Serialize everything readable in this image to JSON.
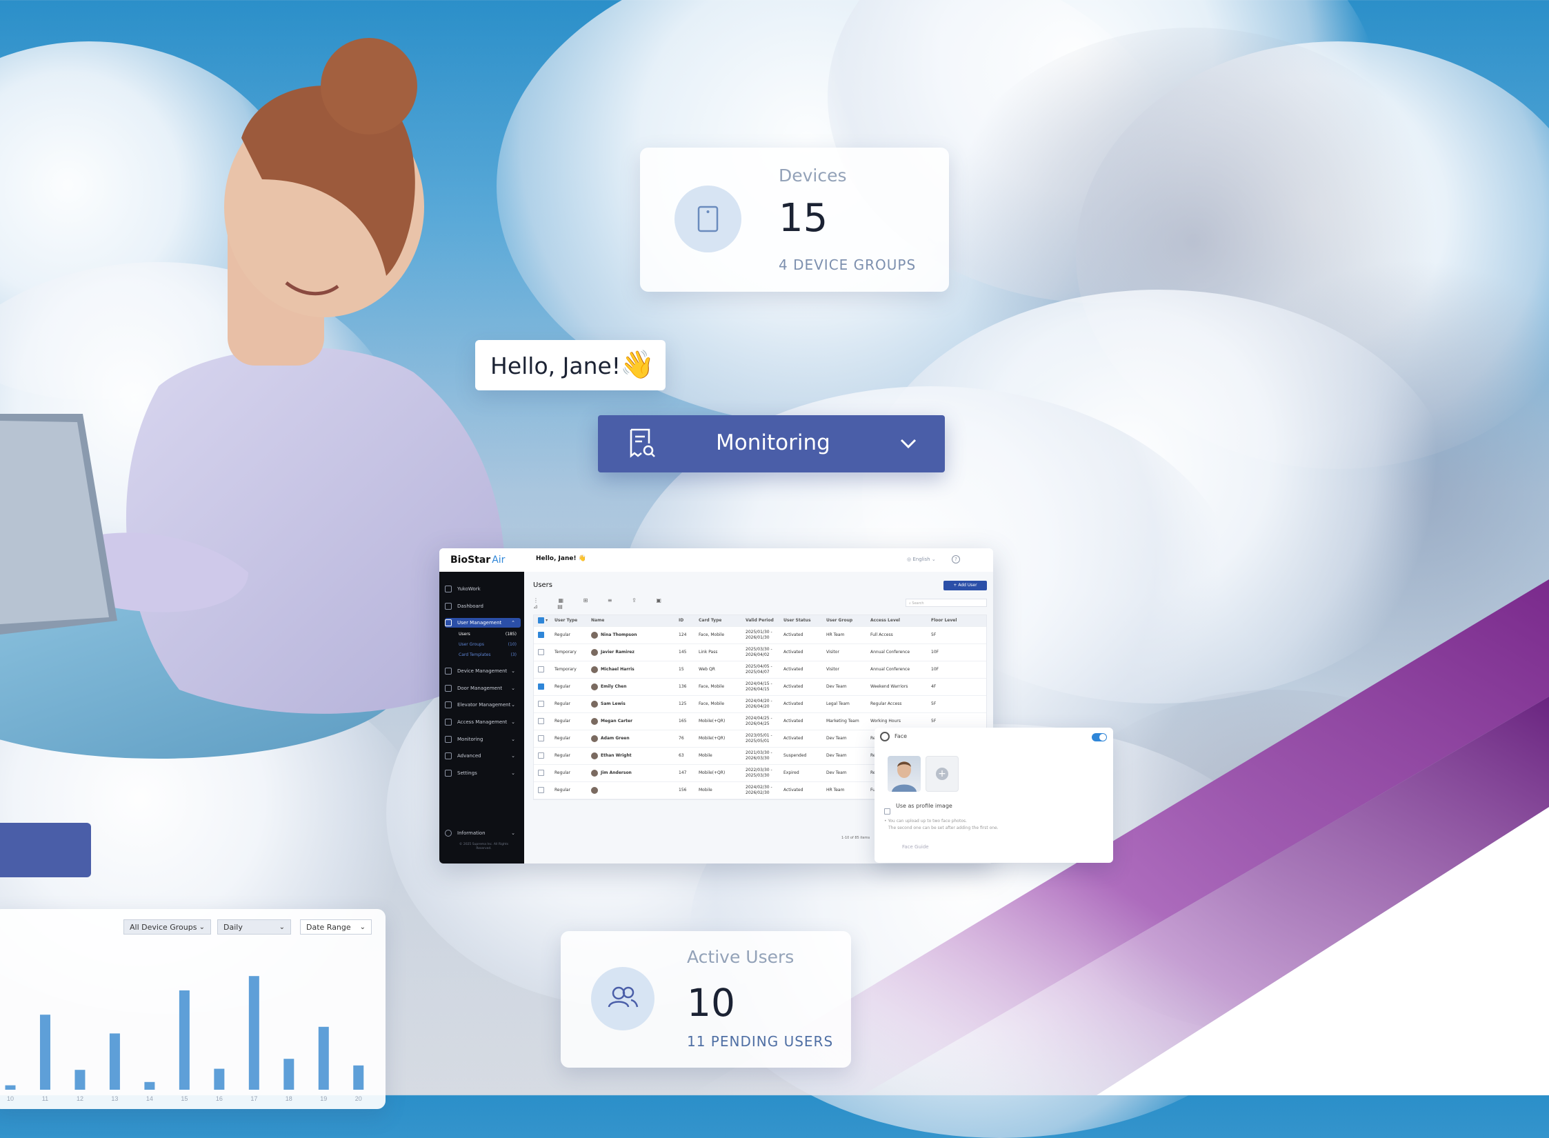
{
  "devices_card": {
    "title": "Devices",
    "value": "15",
    "sub": "4 DEVICE GROUPS",
    "icon": "device-icon"
  },
  "greeting": {
    "text": "Hello, Jane!",
    "emoji": "👋"
  },
  "monitoring_menu": {
    "label": "Monitoring",
    "icon": "monitoring-receipt-icon",
    "chevron": "chevron-down-icon",
    "color": "#4a5ea8"
  },
  "app": {
    "logo_main": "BioStar",
    "logo_accent": "Air",
    "greeting": "Hello, Jane! 👋",
    "language": "English",
    "page_title": "Users",
    "add_user_label": "+ Add User",
    "search_placeholder": "Search",
    "footer_copyright": "© 2025 Suprema Inc. All Rights Reserved.",
    "pagination": "1-10 of 85 items",
    "sidebar": {
      "items": [
        {
          "label": "YukoWork",
          "icon": "building-icon"
        },
        {
          "label": "Dashboard",
          "icon": "dashboard-icon"
        },
        {
          "label": "User Management",
          "icon": "user-icon",
          "active": true
        },
        {
          "label": "Device Management",
          "icon": "device-icon"
        },
        {
          "label": "Door Management",
          "icon": "door-icon"
        },
        {
          "label": "Elevator Management",
          "icon": "elevator-icon"
        },
        {
          "label": "Access Management",
          "icon": "key-icon"
        },
        {
          "label": "Monitoring",
          "icon": "monitor-icon"
        },
        {
          "label": "Advanced",
          "icon": "advanced-icon"
        },
        {
          "label": "Settings",
          "icon": "gear-icon"
        }
      ],
      "subitems": [
        {
          "label": "Users",
          "count": "(185)"
        },
        {
          "label": "User Groups",
          "count": "(10)"
        },
        {
          "label": "Card Templates",
          "count": "(3)"
        }
      ],
      "info_label": "Information"
    },
    "table": {
      "headers": [
        "User Type",
        "Name",
        "ID",
        "Card Type",
        "Valid Period",
        "User Status",
        "User Group",
        "Access Level",
        "Floor Level"
      ],
      "rows": [
        {
          "checked": true,
          "type": "Regular",
          "name": "Nina Thompson",
          "id": "124",
          "card": "Face, Mobile",
          "valid": "2025/01/30 - 2026/01/30",
          "status": "Activated",
          "group": "HR Team",
          "access": "Full Access",
          "floor": "5F"
        },
        {
          "checked": false,
          "type": "Temporary",
          "name": "Javier Ramirez",
          "id": "145",
          "card": "Link Pass",
          "valid": "2025/03/30 - 2026/04/02",
          "status": "Activated",
          "group": "Visitor",
          "access": "Annual Conference",
          "floor": "10F"
        },
        {
          "checked": false,
          "type": "Temporary",
          "name": "Michael Harris",
          "id": "15",
          "card": "Web QR",
          "valid": "2025/04/05 - 2025/04/07",
          "status": "Activated",
          "group": "Visitor",
          "access": "Annual Conference",
          "floor": "10F"
        },
        {
          "checked": true,
          "type": "Regular",
          "name": "Emily Chen",
          "id": "136",
          "card": "Face, Mobile",
          "valid": "2024/04/15 - 2026/04/15",
          "status": "Activated",
          "group": "Dev Team",
          "access": "Weekend Warriors",
          "floor": "4F"
        },
        {
          "checked": false,
          "type": "Regular",
          "name": "Sam Lewis",
          "id": "125",
          "card": "Face, Mobile",
          "valid": "2024/04/20 - 2026/04/20",
          "status": "Activated",
          "group": "Legal Team",
          "access": "Regular Access",
          "floor": "5F"
        },
        {
          "checked": false,
          "type": "Regular",
          "name": "Megan Carter",
          "id": "165",
          "card": "Mobile(+QR)",
          "valid": "2024/04/25 - 2026/04/25",
          "status": "Activated",
          "group": "Marketing Team",
          "access": "Working Hours",
          "floor": "5F"
        },
        {
          "checked": false,
          "type": "Regular",
          "name": "Adam Green",
          "id": "76",
          "card": "Mobile(+QR)",
          "valid": "2023/05/01 - 2025/05/01",
          "status": "Activated",
          "group": "Dev Team",
          "access": "Re",
          "floor": ""
        },
        {
          "checked": false,
          "type": "Regular",
          "name": "Ethan Wright",
          "id": "63",
          "card": "Mobile",
          "valid": "2021/03/30 - 2026/03/30",
          "status": "Suspended",
          "group": "Dev Team",
          "access": "Re",
          "floor": ""
        },
        {
          "checked": false,
          "type": "Regular",
          "name": "Jim Anderson",
          "id": "147",
          "card": "Mobile(+QR)",
          "valid": "2022/03/30 - 2025/03/30",
          "status": "Expired",
          "group": "Dev Team",
          "access": "Re",
          "floor": ""
        },
        {
          "checked": false,
          "type": "Regular",
          "name": "",
          "id": "156",
          "card": "Mobile",
          "valid": "2024/02/30 - 2026/02/30",
          "status": "Activated",
          "group": "HR Team",
          "access": "Fu",
          "floor": ""
        }
      ]
    },
    "face_panel": {
      "label": "Face",
      "checkbox_label": "Use as profile image",
      "note": "• You can upload up to two face photos.",
      "note2": "The second one can be set after adding the first one.",
      "guide": "Face Guide"
    }
  },
  "chart_card": {
    "filters": [
      "All Device Groups",
      "Daily",
      "Date Range"
    ],
    "chart_data": {
      "type": "bar",
      "categories": [
        "10",
        "11",
        "12",
        "13",
        "14",
        "15",
        "16",
        "17",
        "18",
        "19",
        "20"
      ],
      "values": [
        0.4,
        6.8,
        1.8,
        5.1,
        0.7,
        9.0,
        1.9,
        10.3,
        2.8,
        5.7,
        2.2
      ],
      "ylim": [
        0,
        12
      ],
      "grid": false,
      "color": "#5e9fd8"
    }
  },
  "active_users_card": {
    "title": "Active Users",
    "value": "10",
    "sub": "11 PENDING USERS",
    "icon": "users-icon"
  }
}
